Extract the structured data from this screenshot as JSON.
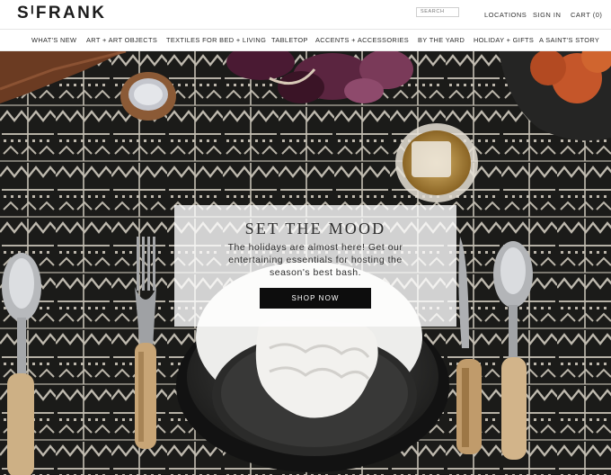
{
  "brand": {
    "logo_text": "SᴵFRANK"
  },
  "header": {
    "search_placeholder": "SEARCH",
    "locations": "LOCATIONS",
    "sign_in": "SIGN IN",
    "cart": "CART (0)"
  },
  "nav": {
    "items": [
      "WHAT'S NEW",
      "ART + ART OBJECTS",
      "TEXTILES FOR BED + LIVING",
      "TABLETOP",
      "ACCENTS + ACCESSORIES",
      "BY THE YARD",
      "HOLIDAY + GIFTS",
      "A SAINT'S STORY"
    ]
  },
  "hero": {
    "title": "SET THE MOOD",
    "text": "The holidays are almost here! Get our entertaining essentials for hosting the season's best bash.",
    "cta": "SHOP NOW"
  }
}
